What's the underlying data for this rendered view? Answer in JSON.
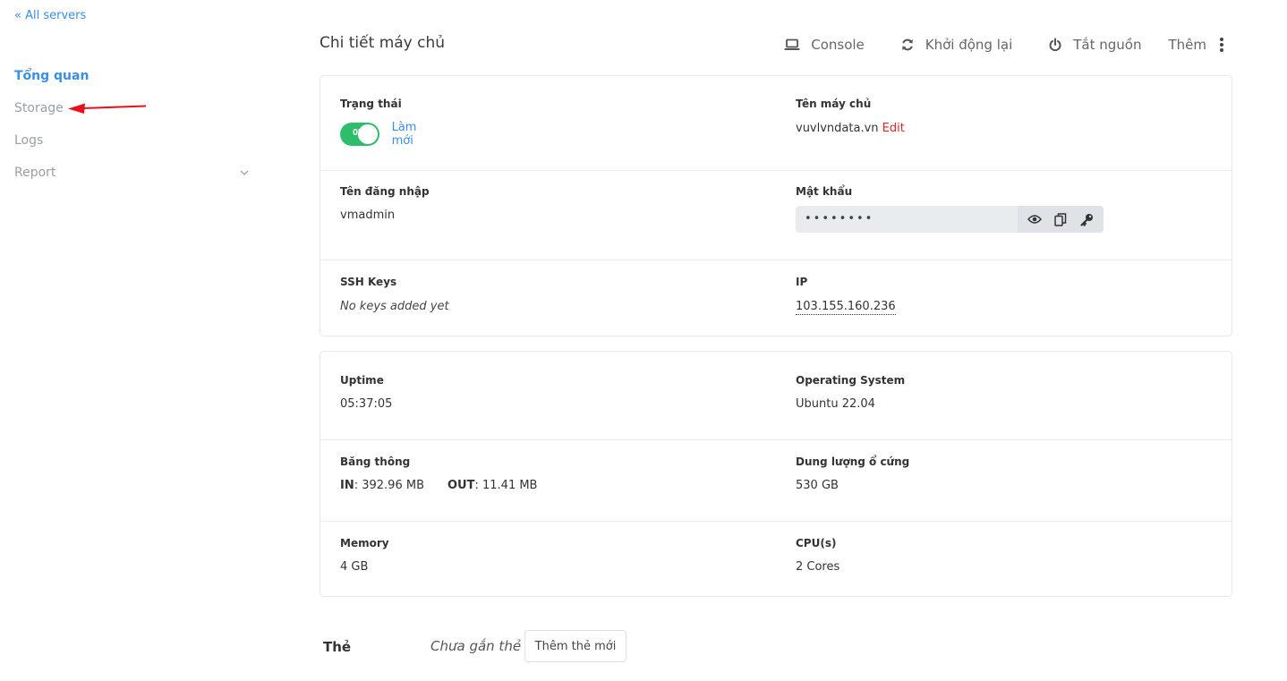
{
  "sidebar": {
    "back_link": "« All servers",
    "items": [
      {
        "label": "Tổng quan",
        "active": true
      },
      {
        "label": "Storage",
        "active": false
      },
      {
        "label": "Logs",
        "active": false
      },
      {
        "label": "Report",
        "active": false,
        "has_submenu": true
      }
    ]
  },
  "header": {
    "title": "Chi tiết máy chủ",
    "actions": [
      {
        "label": "Console",
        "icon": "laptop-icon"
      },
      {
        "label": "Khởi động lại",
        "icon": "refresh-icon"
      },
      {
        "label": "Tắt nguồn",
        "icon": "power-icon"
      },
      {
        "label": "Thêm",
        "icon": "kebab-menu-icon"
      }
    ]
  },
  "details": {
    "status_label": "Trạng thái",
    "status_toggle": "ON",
    "refresh_link": "Làm mới",
    "hostname_label": "Tên máy chủ",
    "hostname": "vuvlvndata.vn",
    "hostname_edit": "Edit",
    "username_label": "Tên đăng nhập",
    "username": "vmadmin",
    "password_label": "Mật khẩu",
    "password_masked": "••••••••",
    "ssh_label": "SSH Keys",
    "ssh_value": "No keys added yet",
    "ip_label": "IP",
    "ip_value": "103.155.160.236"
  },
  "stats": {
    "uptime_label": "Uptime",
    "uptime": "05:37:05",
    "os_label": "Operating System",
    "os": "Ubuntu 22.04",
    "bandwidth_label": "Băng thông",
    "bw_in_label": "IN",
    "bw_in": ": 392.96 MB",
    "bw_out_label": "OUT",
    "bw_out": ": 11.41 MB",
    "disk_label": "Dung lượng ổ cứng",
    "disk": "530 GB",
    "memory_label": "Memory",
    "memory": "4 GB",
    "cpu_label": "CPU(s)",
    "cpu": "2 Cores"
  },
  "tags": {
    "label": "Thẻ",
    "empty": "Chưa gắn thẻ",
    "add_button": "Thêm thẻ mới"
  },
  "colors": {
    "accent": "#3a8ee6",
    "toggle_on": "#2ebd6b",
    "edit": "#e02424",
    "annotation_arrow": "#e8101a"
  }
}
